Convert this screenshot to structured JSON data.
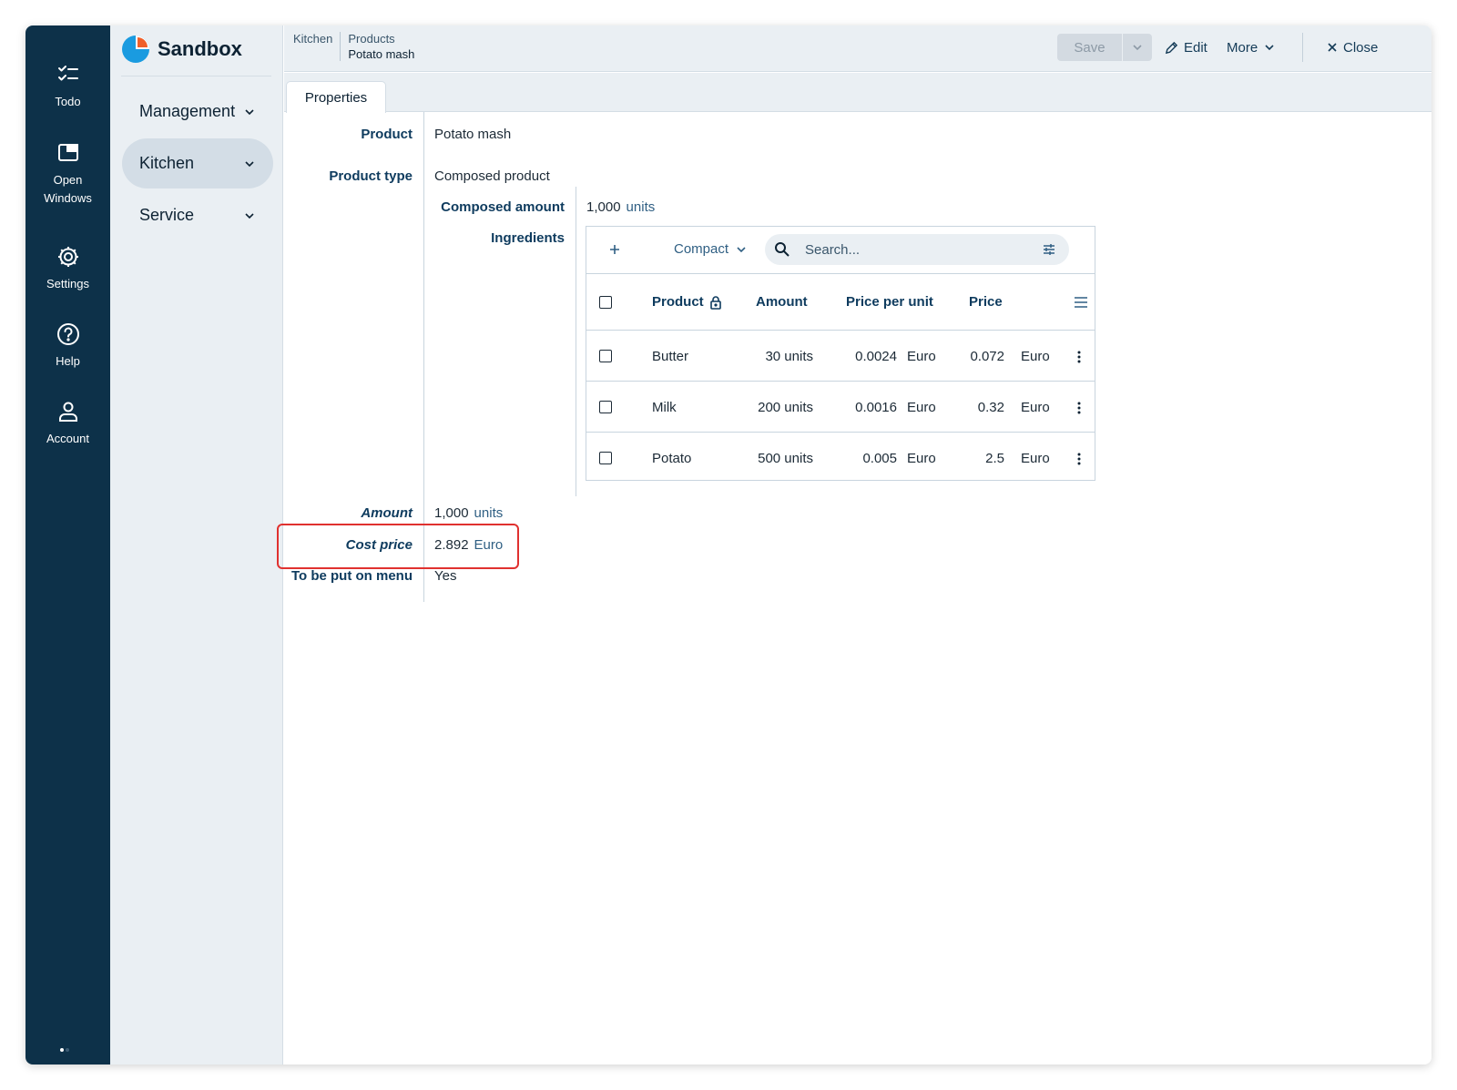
{
  "rail": {
    "items": [
      {
        "label": "Todo"
      },
      {
        "label": "Open Windows"
      },
      {
        "label": "Settings"
      },
      {
        "label": "Help"
      },
      {
        "label": "Account"
      }
    ]
  },
  "nav": {
    "brand": "Sandbox",
    "items": [
      {
        "label": "Management"
      },
      {
        "label": "Kitchen"
      },
      {
        "label": "Service"
      }
    ]
  },
  "breadcrumb": {
    "root": "Kitchen",
    "section": "Products",
    "current": "Potato mash"
  },
  "toolbar": {
    "save_label": "Save",
    "edit_label": "Edit",
    "more_label": "More",
    "close_label": "Close"
  },
  "tabs": [
    {
      "label": "Properties"
    }
  ],
  "form": {
    "product_label": "Product",
    "product_value": "Potato mash",
    "product_type_label": "Product type",
    "product_type_value": "Composed product",
    "composed_amount_label": "Composed amount",
    "composed_amount_value": "1,000",
    "composed_amount_unit": "units",
    "ingredients_label": "Ingredients",
    "amount_label": "Amount",
    "amount_value": "1,000",
    "amount_unit": "units",
    "cost_price_label": "Cost price",
    "cost_price_value": "2.892",
    "cost_price_unit": "Euro",
    "menu_label": "To be put on menu",
    "menu_value": "Yes"
  },
  "ingredients": {
    "view_mode": "Compact",
    "search_placeholder": "Search...",
    "columns": [
      "Product",
      "Amount",
      "Price per unit",
      "Price"
    ],
    "rows": [
      {
        "product": "Butter",
        "amount": "30 units",
        "ppu": "0.0024",
        "ppu_unit": "Euro",
        "price": "0.072",
        "price_unit": "Euro"
      },
      {
        "product": "Milk",
        "amount": "200 units",
        "ppu": "0.0016",
        "ppu_unit": "Euro",
        "price": "0.32",
        "price_unit": "Euro"
      },
      {
        "product": "Potato",
        "amount": "500 units",
        "ppu": "0.005",
        "ppu_unit": "Euro",
        "price": "2.5",
        "price_unit": "Euro"
      }
    ]
  },
  "colors": {
    "rail_bg": "#0d3149",
    "nav_bg": "#eaeff3",
    "label_blue": "#0e3b5e",
    "highlight_red": "#e0312f",
    "brand_blue": "#1a9be0",
    "brand_orange": "#f0602a"
  }
}
